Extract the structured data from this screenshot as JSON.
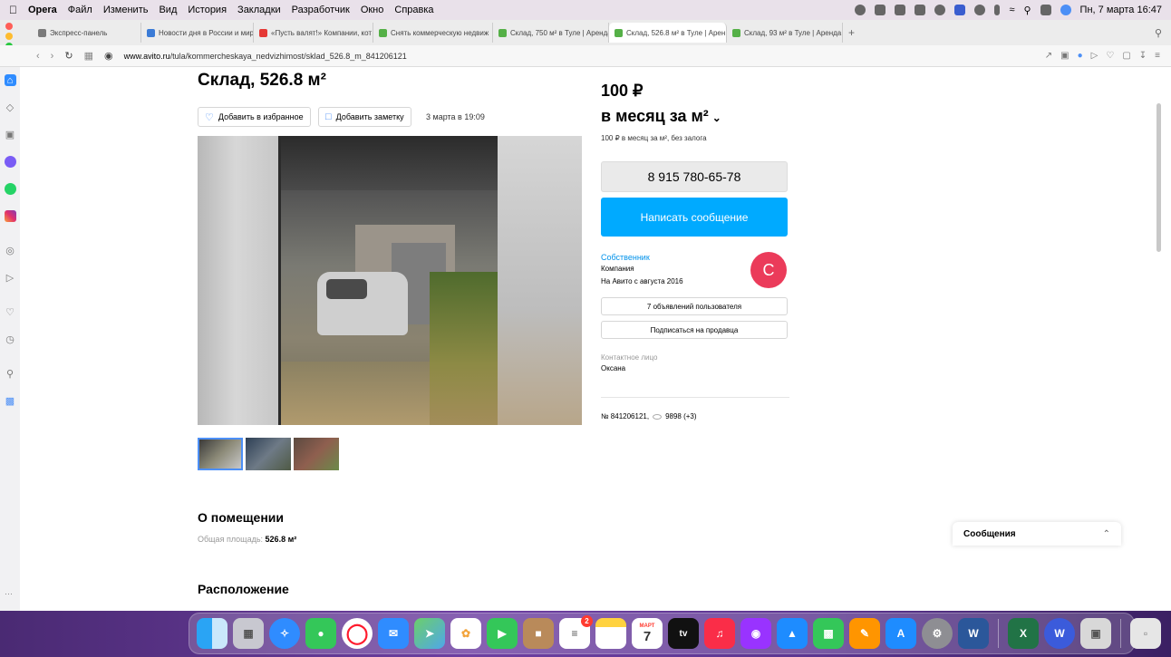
{
  "menubar": {
    "app_name": "Opera",
    "items": [
      "Файл",
      "Изменить",
      "Вид",
      "История",
      "Закладки",
      "Разработчик",
      "Окно",
      "Справка"
    ],
    "datetime": "Пн, 7 марта 16:47"
  },
  "tabs": [
    {
      "label": "Экспресс-панель",
      "color": "#7a7a7a"
    },
    {
      "label": "Новости дня в России и мире",
      "color": "#3b7bd6"
    },
    {
      "label": "«Пусть валят!» Компании, кот",
      "color": "#e53935"
    },
    {
      "label": "Снять коммерческую недвиж",
      "color": "#55b047"
    },
    {
      "label": "Склад, 750 м² в Туле | Аренда",
      "color": "#55b047"
    },
    {
      "label": "Склад, 526.8 м² в Туле | Арен",
      "color": "#55b047",
      "active": true
    },
    {
      "label": "Склад, 93 м² в Туле | Аренда",
      "color": "#55b047"
    }
  ],
  "address": {
    "domain": "www.avito.ru",
    "path": "/tula/kommercheskaya_nedvizhimost/sklad_526.8_m_841206121"
  },
  "listing": {
    "title": "Склад, 526.8 м²",
    "fav_label": "Добавить в избранное",
    "note_label": "Добавить заметку",
    "date": "3 марта в 19:09",
    "section_about": "О помещении",
    "area_label": "Общая площадь:",
    "area_value": "526.8 м²",
    "section_location": "Расположение"
  },
  "price": {
    "amount": "100 ₽",
    "unit": "в месяц за м²",
    "note": "100 ₽ в месяц за м², без залога"
  },
  "contact": {
    "phone": "8 915 780-65-78",
    "message_label": "Написать сообщение",
    "seller_role": "Собственник",
    "seller_type": "Компания",
    "seller_since": "На Авито с августа 2016",
    "avatar_letter": "С",
    "listings_label": "7 объявлений пользователя",
    "subscribe_label": "Подписаться на продавца",
    "contact_person_label": "Контактное лицо",
    "contact_person_name": "Оксана"
  },
  "stats": {
    "listing_id": "№ 841206121,",
    "views": "9898 (+3)"
  },
  "chat": {
    "label": "Сообщения"
  },
  "dock": {
    "calendar_month": "МАРТ",
    "calendar_day": "7",
    "reminders_badge": "2"
  },
  "colors": {
    "accent_blue": "#00aaff",
    "avatar_red": "#eb3b5a",
    "link_blue": "#0091ea"
  }
}
